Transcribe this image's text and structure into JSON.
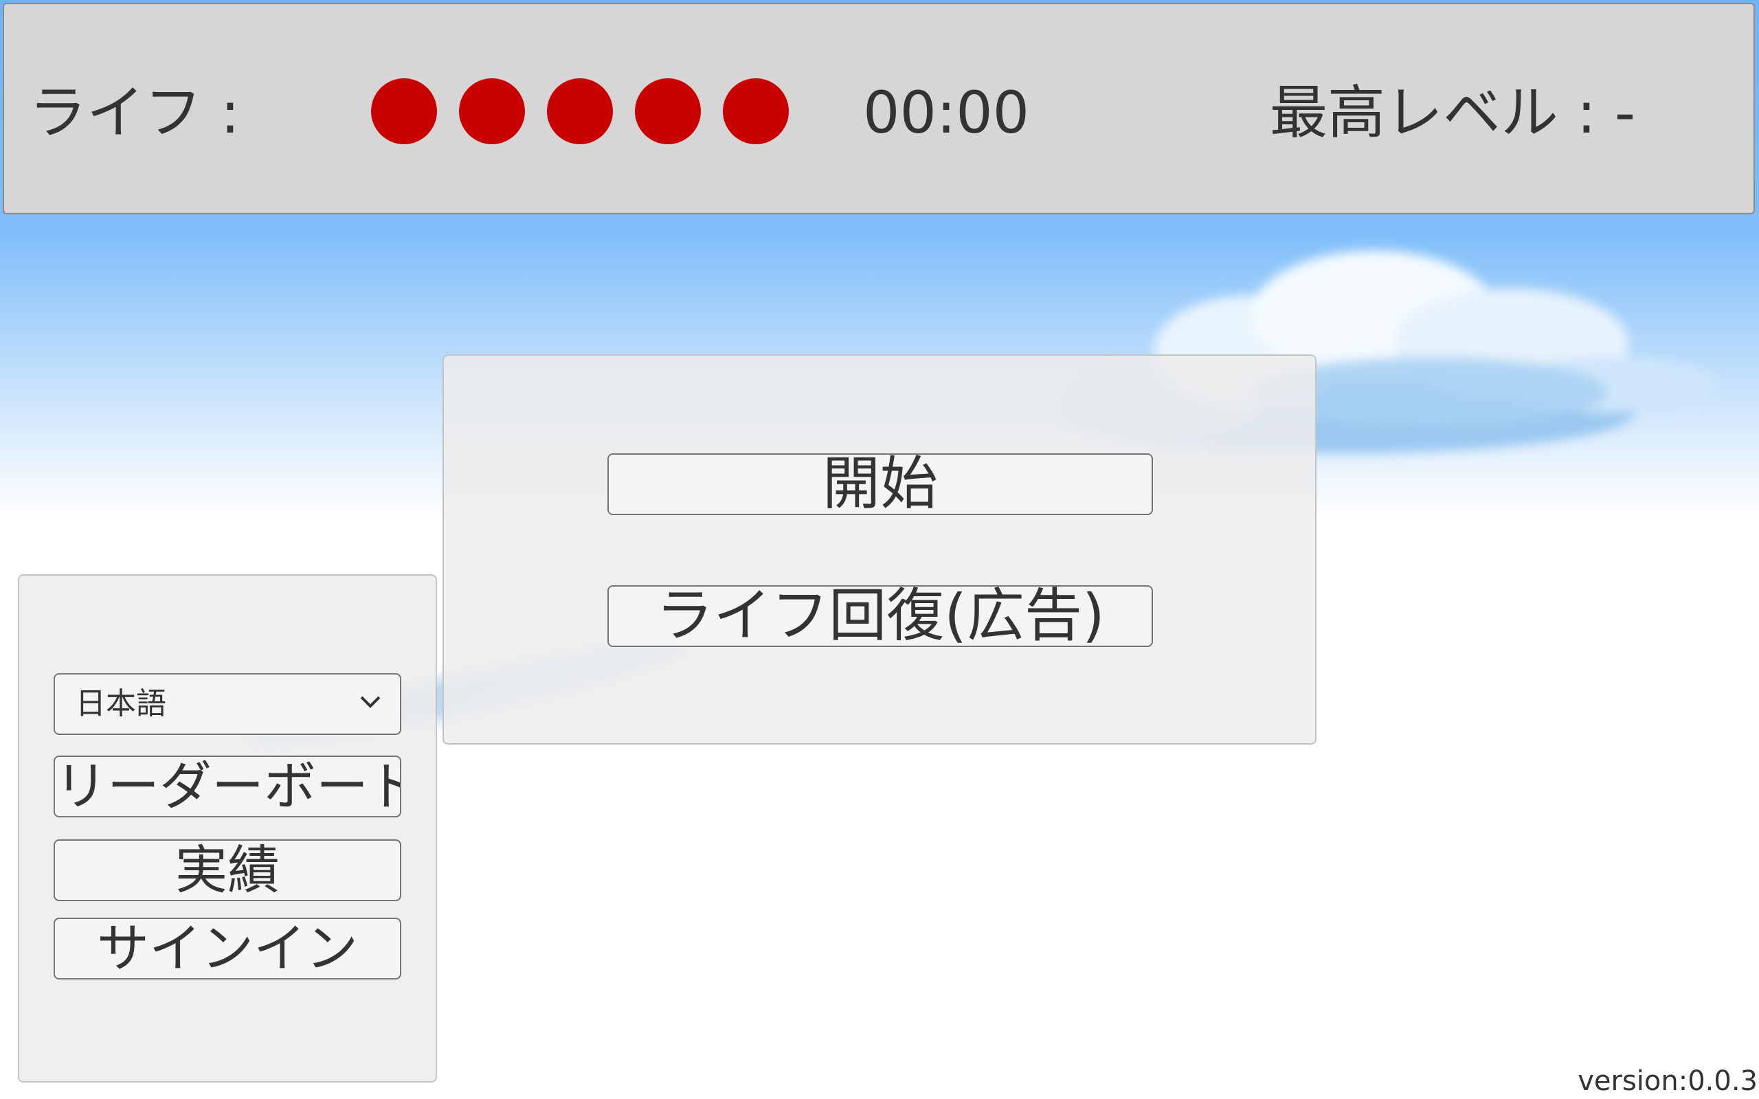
{
  "header": {
    "life_label": "ライフ :",
    "lives_remaining": 5,
    "life_color": "#c80000",
    "timer": "00:00",
    "best_level": "最高レベル : -"
  },
  "main_menu": {
    "start_label": "開始",
    "revive_label": "ライフ回復(広告)"
  },
  "side_menu": {
    "language": {
      "selected": "日本語",
      "icon": "chevron-down-icon"
    },
    "leaderboard_label": "リーダーボード",
    "achievements_label": "実績",
    "signin_label": "サインイン"
  },
  "footer": {
    "version": "version:0.0.3"
  },
  "colors": {
    "sky_top": "#6fb4f8",
    "header_bg": "#d6d6d6",
    "button_bg": "#f4f4f4"
  }
}
